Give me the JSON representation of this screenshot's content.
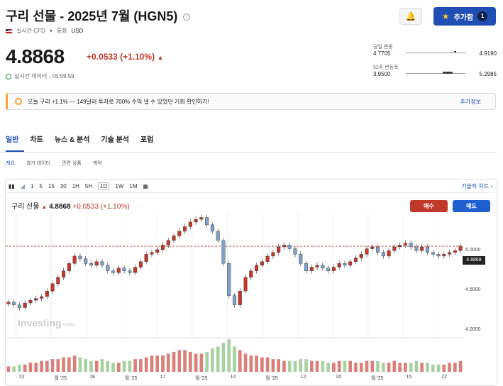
{
  "header": {
    "title": "구리 선물 - 2025년 7월 (HGN5)",
    "info_icon": "i",
    "market": "실시간 CFD",
    "currency_label": "통화",
    "currency": "USD",
    "alert_icon": "bell-plus-icon",
    "add_label": "추가함",
    "add_count": "1"
  },
  "quote": {
    "price": "4.8868",
    "change": "+0.0533",
    "change_pct": "(+1.10%)",
    "realtime_label": "실시간 데이터 - 05:59:59"
  },
  "ranges": {
    "day_label": "금일 변동",
    "day_low": "4.7705",
    "day_high": "4.9190",
    "week52_label": "52주 변동폭",
    "week52_low": "3.9500",
    "week52_high": "5.2985"
  },
  "banner": {
    "text": "오늘 구리 +1.1% — 149달러 투자로 700% 수익 낼 수 있었던 기회 확인하기!",
    "more": "추가정보"
  },
  "tabs": [
    "일반",
    "차트",
    "뉴스 & 분석",
    "기술 분석",
    "포럼"
  ],
  "subtabs": [
    "개요",
    "과거 데이터",
    "관련 상품",
    "계약"
  ],
  "toolbar": {
    "intervals": [
      "1",
      "5",
      "15",
      "30",
      "1H",
      "5H",
      "1D",
      "1W",
      "1M"
    ],
    "selected": "1D",
    "tech_chart": "기술적 차트 ›"
  },
  "chart_head": {
    "name": "구리 선물",
    "price": "4.8868",
    "change": "+0.0533",
    "change_pct": "(+1.10%)"
  },
  "trade": {
    "buy": "매수",
    "sell": "매도"
  },
  "watermark": {
    "brand": "Investing",
    "suffix": ".com"
  },
  "chart_data": {
    "type": "candlestick",
    "ylim": [
      3.9,
      5.25
    ],
    "yticks": [
      "5.0000",
      "4.5000",
      "4.0000"
    ],
    "last_price": "4.8868",
    "xticks": [
      "22",
      "월 '25",
      "18",
      "월 '25",
      "17",
      "월 '25",
      "14",
      "월 '25",
      "12",
      "20",
      "월 '25",
      "15",
      "22"
    ],
    "closes": [
      4.28,
      4.25,
      4.22,
      4.27,
      4.3,
      4.32,
      4.34,
      4.4,
      4.48,
      4.55,
      4.62,
      4.7,
      4.78,
      4.75,
      4.7,
      4.68,
      4.72,
      4.68,
      4.62,
      4.6,
      4.65,
      4.62,
      4.6,
      4.66,
      4.72,
      4.8,
      4.82,
      4.85,
      4.9,
      4.95,
      5.0,
      5.05,
      5.1,
      5.15,
      5.18,
      5.2,
      5.12,
      5.05,
      4.95,
      4.7,
      4.35,
      4.25,
      4.4,
      4.55,
      4.62,
      4.68,
      4.72,
      4.78,
      4.82,
      4.88,
      4.9,
      4.86,
      4.8,
      4.7,
      4.62,
      4.66,
      4.68,
      4.65,
      4.62,
      4.66,
      4.7,
      4.68,
      4.72,
      4.76,
      4.8,
      4.86,
      4.88,
      4.82,
      4.78,
      4.84,
      4.88,
      4.9,
      4.92,
      4.88,
      4.84,
      4.88,
      4.82,
      4.8,
      4.78,
      4.8,
      4.82,
      4.84,
      4.89
    ],
    "volumes": [
      3,
      3,
      4,
      4,
      5,
      5,
      6,
      6,
      7,
      7,
      8,
      8,
      9,
      8,
      7,
      6,
      6,
      7,
      6,
      5,
      5,
      6,
      6,
      7,
      7,
      8,
      9,
      9,
      9,
      10,
      11,
      12,
      12,
      11,
      10,
      10,
      11,
      13,
      14,
      16,
      18,
      14,
      12,
      10,
      9,
      9,
      8,
      8,
      7,
      7,
      6,
      6,
      6,
      7,
      7,
      6,
      6,
      6,
      5,
      5,
      6,
      6,
      6,
      5,
      5,
      6,
      6,
      6,
      5,
      5,
      6,
      5,
      5,
      5,
      6,
      5,
      5,
      4,
      4,
      4,
      5,
      5,
      6
    ]
  }
}
